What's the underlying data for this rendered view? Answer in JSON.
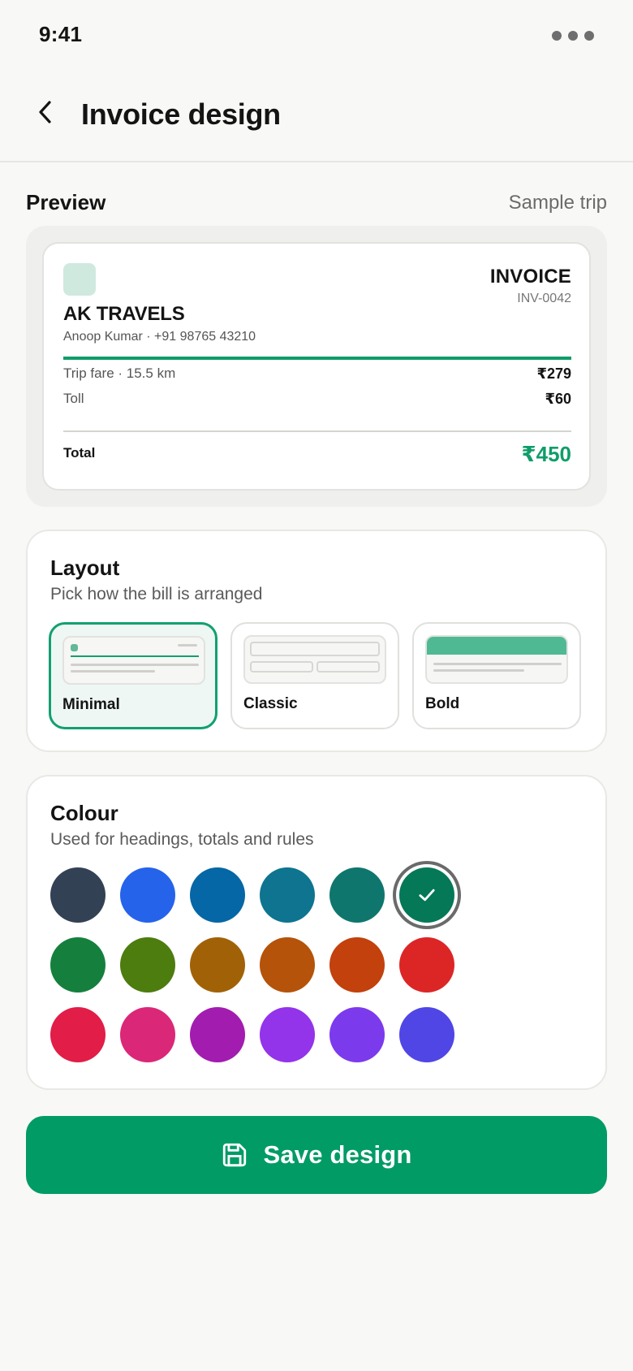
{
  "status": {
    "time": "9:41"
  },
  "header": {
    "title": "Invoice design"
  },
  "preview": {
    "heading": "Preview",
    "sample_label": "Sample trip",
    "invoice": {
      "company": "AK TRAVELS",
      "contact": "Anoop Kumar · +91 98765 43210",
      "title": "INVOICE",
      "number": "INV-0042",
      "rows": [
        {
          "label": "Trip fare · 15.5 km",
          "value": "₹279"
        },
        {
          "label": "Toll",
          "value": "₹60"
        }
      ],
      "total_label": "Total",
      "total_value": "₹450",
      "accent": "#0f9d69"
    }
  },
  "layout": {
    "title": "Layout",
    "subtitle": "Pick how the bill is arranged",
    "options": [
      {
        "label": "Minimal",
        "selected": true
      },
      {
        "label": "Classic",
        "selected": false
      },
      {
        "label": "Bold",
        "selected": false
      }
    ]
  },
  "colour": {
    "title": "Colour",
    "subtitle": "Used for headings, totals and rules",
    "swatches": [
      "#334155",
      "#2563eb",
      "#0567a5",
      "#0e7490",
      "#0f766e",
      "#047857",
      "#15803d",
      "#4d7c0f",
      "#a16207",
      "#b45309",
      "#c2410c",
      "#dc2626",
      "#e11d48",
      "#db2777",
      "#a21caf",
      "#9333ea",
      "#7c3aed",
      "#4f46e5"
    ],
    "selected_index": 5
  },
  "save_button": {
    "label": "Save design",
    "icon": "save-icon",
    "color": "#019b66"
  }
}
